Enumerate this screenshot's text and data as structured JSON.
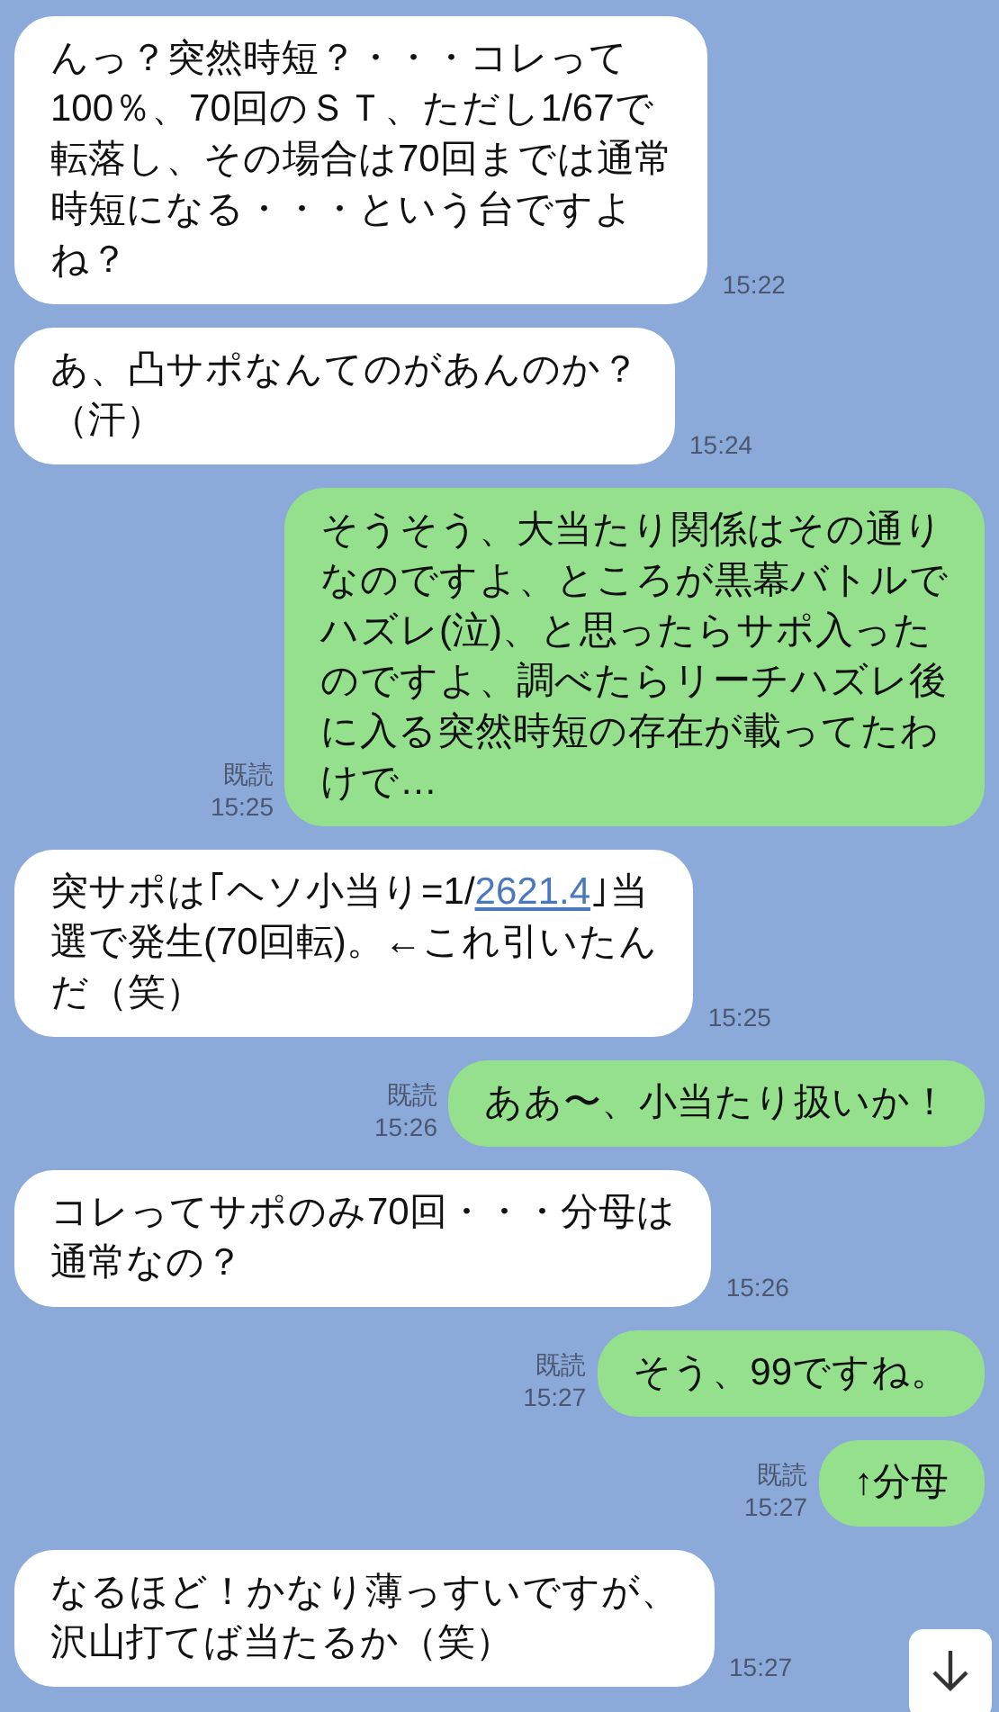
{
  "messages": [
    {
      "kind": "received",
      "lines": [
        "んっ？突然時短？・・・コレって",
        "100％、70回のＳＴ、ただし1/67で",
        "転落し、その場合は70回までは通常",
        "時短になる・・・という台ですよ",
        "ね？"
      ],
      "time": "15:22"
    },
    {
      "kind": "received",
      "lines": [
        "あ、凸サポなんてのがあんのか？",
        "（汗）"
      ],
      "time": "15:24"
    },
    {
      "kind": "sent",
      "lines": [
        "そうそう、大当たり関係はその通り",
        "なのですよ、ところが黒幕バトルで",
        "ハズレ(泣)、と思ったらサポ入った",
        "のですよ、調べたらリーチハズレ後",
        "に入る突然時短の存在が載ってたわ",
        "けで…"
      ],
      "read": "既読",
      "time": "15:25"
    },
    {
      "kind": "received",
      "lines": [
        [
          {
            "text": "突サポは｢ヘソ小当り=1/"
          },
          {
            "text": "2621.4",
            "kind": "link"
          },
          {
            "text": "｣当"
          }
        ],
        "選で発生(70回転)。←これ引いたん",
        "だ（笑）"
      ],
      "time": "15:25"
    },
    {
      "kind": "sent",
      "lines": [
        "ああ〜、小当たり扱いか！"
      ],
      "read": "既読",
      "time": "15:26"
    },
    {
      "kind": "received",
      "lines": [
        "コレってサポのみ70回・・・分母は",
        "通常なの？"
      ],
      "time": "15:26"
    },
    {
      "kind": "sent",
      "lines": [
        "そう、99ですね。"
      ],
      "read": "既読",
      "time": "15:27"
    },
    {
      "kind": "sent",
      "lines": [
        "↑分母"
      ],
      "read": "既読",
      "time": "15:27"
    },
    {
      "kind": "received",
      "lines": [
        "なるほど！かなり薄っすいですが、",
        "沢山打てば当たるか（笑）"
      ],
      "time": "15:27"
    }
  ]
}
